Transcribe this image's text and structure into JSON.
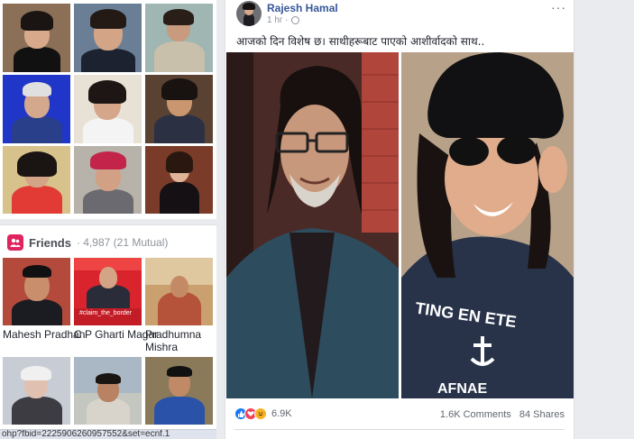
{
  "friends": {
    "title": "Friends",
    "count": "· 4,987 (21 Mutual)",
    "names": [
      "Mahesh Pradhan",
      "C P Gharti Magar",
      "Pradhumna",
      "Mishra"
    ],
    "card_banner_text": "#claim_the_border"
  },
  "status_url": "ohp?fbid=2225906260957552&set=ecnf.1",
  "post": {
    "author": "Rajesh Hamal",
    "time": "1 hr ·",
    "more": "···",
    "caption": "आजको दिन विशेष छ। साथीहरूबाट पाएको आशीर्वादको साथ..",
    "reaction_count": "6.9K",
    "comments": "1.6K Comments",
    "shares": "84 Shares",
    "shirt_text": [
      "TING EN ETE",
      "AFNAE"
    ]
  },
  "icons": [
    "friends-icon",
    "globe-icon",
    "more-options-icon",
    "like-reaction-icon",
    "love-reaction-icon",
    "haha-reaction-icon"
  ],
  "colors": {
    "link": "#365899",
    "friends_badge": "#e0245e",
    "like": "#1877f2",
    "love": "#f33e58",
    "haha": "#f7b125"
  }
}
